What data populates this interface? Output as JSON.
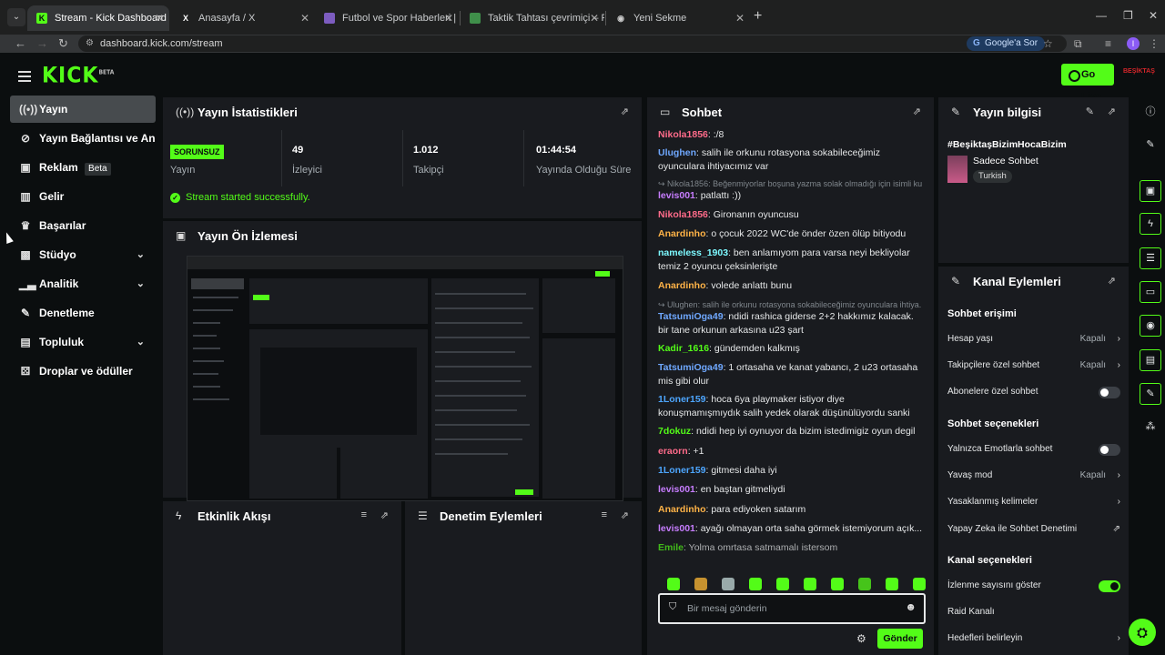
{
  "browser": {
    "tabs": [
      {
        "title": "Stream - Kick Dashboard",
        "icon": "kick-icon",
        "active": true
      },
      {
        "title": "Anasayfa / X",
        "icon": "x-icon"
      },
      {
        "title": "Futbol ve Spor Haberleri | Maç",
        "icon": "site-icon"
      },
      {
        "title": "Taktik Tahtası çevrimiçi – Futbol",
        "icon": "board-icon"
      },
      {
        "title": "Yeni Sekme",
        "icon": "chrome-icon"
      }
    ],
    "url": "dashboard.kick.com/stream",
    "google_ask": "Google'a Sor",
    "profile_initial": "I"
  },
  "header": {
    "logo": "KICK",
    "logo_sup": "BETA",
    "go_live": "Go Live",
    "user_badge": "BEŞİKTAŞ"
  },
  "sidebar": {
    "items": [
      {
        "label": "Yayın",
        "icon": "broadcast-icon"
      },
      {
        "label": "Yayın Bağlantısı ve Anahtar",
        "icon": "link-icon"
      },
      {
        "label": "Reklam",
        "badge": "Beta",
        "icon": "ad-icon"
      },
      {
        "label": "Gelir",
        "icon": "chart-icon"
      },
      {
        "label": "Başarılar",
        "icon": "trophy-icon"
      },
      {
        "label": "Stüdyo",
        "icon": "studio-icon"
      },
      {
        "label": "Analitik",
        "icon": "analytics-icon"
      },
      {
        "label": "Denetleme",
        "icon": "wrench-icon"
      },
      {
        "label": "Topluluk",
        "icon": "community-icon"
      },
      {
        "label": "Droplar ve ödüller",
        "icon": "gift-icon"
      }
    ]
  },
  "stats": {
    "title": "Yayın İstatistikleri",
    "status": "SORUNSUZ",
    "status_label": "Yayın",
    "viewers": "49",
    "viewers_label": "İzleyici",
    "followers": "1.012",
    "followers_label": "Takipçi",
    "uptime": "01:44:54",
    "uptime_label": "Yayında Olduğu Süre",
    "message": "Stream started successfully."
  },
  "preview": {
    "title": "Yayın Ön İzlemesi"
  },
  "activity": {
    "title": "Etkinlik Akışı"
  },
  "moderation": {
    "title": "Denetim Eylemleri"
  },
  "chat": {
    "title": "Sohbet",
    "messages": [
      {
        "user": "Nikola1856",
        "text": ":/8",
        "color": "#ff6b8a"
      },
      {
        "user": "Ulughen",
        "text": "salih ile orkunu rotasyona sokabileceğimiz oyunculara ihtiyacımız var",
        "color": "#6fa8ff"
      },
      {
        "reply": "↪ Nikola1856: Beğenmiyorlar boşuna yazma solak olmadığı için isimli kull..."
      },
      {
        "user": "levis001",
        "text": "patlattı :))",
        "color": "#c77dff"
      },
      {
        "user": "Nikola1856",
        "text": "Gironanın oyuncusu",
        "color": "#ff6b8a"
      },
      {
        "user": "Anardinho",
        "text": "o çocuk 2022 WC'de önder özen ölüp bitiyodu",
        "color": "#ffb347"
      },
      {
        "user": "nameless_1903",
        "text": "ben anlamıyom para varsa neyi bekliyolar temiz 2 oyuncu çeksinlerişte",
        "color": "#7df9ff"
      },
      {
        "user": "Anardinho",
        "text": "volede anlattı bunu",
        "color": "#ffb347"
      },
      {
        "reply": "↪ Ulughen: salih ile orkunu rotasyona sokabileceğimiz oyunculara ihtiya..."
      },
      {
        "user": "TatsumiOga49",
        "text": "ndidi rashica giderse 2+2 hakkımız kalacak. bir tane orkunun arkasına u23 şart",
        "color": "#6fa8ff"
      },
      {
        "user": "Kadir_1616",
        "text": "gündemden kalkmış",
        "color": "#53fc18"
      },
      {
        "user": "TatsumiOga49",
        "text": "1 ortasaha ve kanat yabancı, 2 u23 ortasaha mis gibi olur",
        "color": "#6fa8ff"
      },
      {
        "user": "1Loner159",
        "text": "hoca 6ya playmaker istiyor diye konuşmamışmıydık salih yedek olarak düşünülüyordu sanki",
        "color": "#4da6ff"
      },
      {
        "user": "7dokuz",
        "text": "ndidi hep iyi oynuyor da bizim istedimigiz oyun degil",
        "color": "#53fc18"
      },
      {
        "user": "eraorn",
        "text": "+1",
        "color": "#ff6b8a"
      },
      {
        "user": "1Loner159",
        "text": "gitmesi daha iyi",
        "color": "#4da6ff"
      },
      {
        "user": "levis001",
        "text": "en baştan gitmeliydi",
        "color": "#c77dff"
      },
      {
        "user": "Anardinho",
        "text": "para ediyoken satarım",
        "color": "#ffb347"
      },
      {
        "user": "levis001",
        "text": "ayağı olmayan orta saha görmek istemiyorum açık...",
        "color": "#c77dff"
      },
      {
        "user": "Emile",
        "text": "Yolma omrtasa satmamalı istersom",
        "color": "#53fc18"
      }
    ],
    "placeholder": "Bir mesaj gönderin",
    "send": "Gönder"
  },
  "stream_info": {
    "title": "Yayın bilgisi",
    "hashtag": "#BeşiktaşBizimHocaBizim",
    "category": "Sadece Sohbet",
    "language": "Turkish"
  },
  "channel_actions": {
    "title": "Kanal Eylemleri",
    "chat_access": "Sohbet erişimi",
    "account_age": "Hesap yaşı",
    "account_age_value": "Kapalı",
    "followers_only": "Takipçilere özel sohbet",
    "followers_only_value": "Kapalı",
    "subs_only": "Abonelere özel sohbet",
    "chat_options": "Sohbet seçenekleri",
    "emotes_only": "Yalnızca Emotlarla sohbet",
    "slow_mode": "Yavaş mod",
    "slow_mode_value": "Kapalı",
    "banned_words": "Yasaklanmış kelimeler",
    "ai_moderation": "Yapay Zeka ile Sohbet Denetimi",
    "channel_options": "Kanal seçenekleri",
    "show_viewers": "İzlenme sayısını göster",
    "raid": "Raid Kanalı",
    "goals": "Hedefleri belirleyin"
  }
}
